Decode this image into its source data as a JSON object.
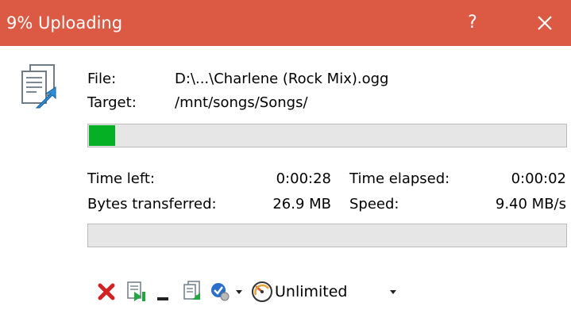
{
  "window": {
    "title": "9% Uploading",
    "help_label": "?"
  },
  "labels": {
    "file": "File:",
    "target": "Target:",
    "time_left": "Time left:",
    "time_elapsed": "Time elapsed:",
    "bytes_transferred": "Bytes transferred:",
    "speed": "Speed:"
  },
  "transfer": {
    "file": "D:\\...\\Charlene (Rock Mix).ogg",
    "target": "/mnt/songs/Songs/",
    "time_left": "0:00:28",
    "time_elapsed": "0:00:02",
    "bytes_transferred": "26.9 MB",
    "speed": "9.40 MB/s",
    "file_progress_percent": 9,
    "total_progress_percent": 0
  },
  "toolbar": {
    "speed_limit": "Unlimited"
  },
  "colors": {
    "titlebar": "#dc5a43",
    "progress": "#06b025"
  }
}
